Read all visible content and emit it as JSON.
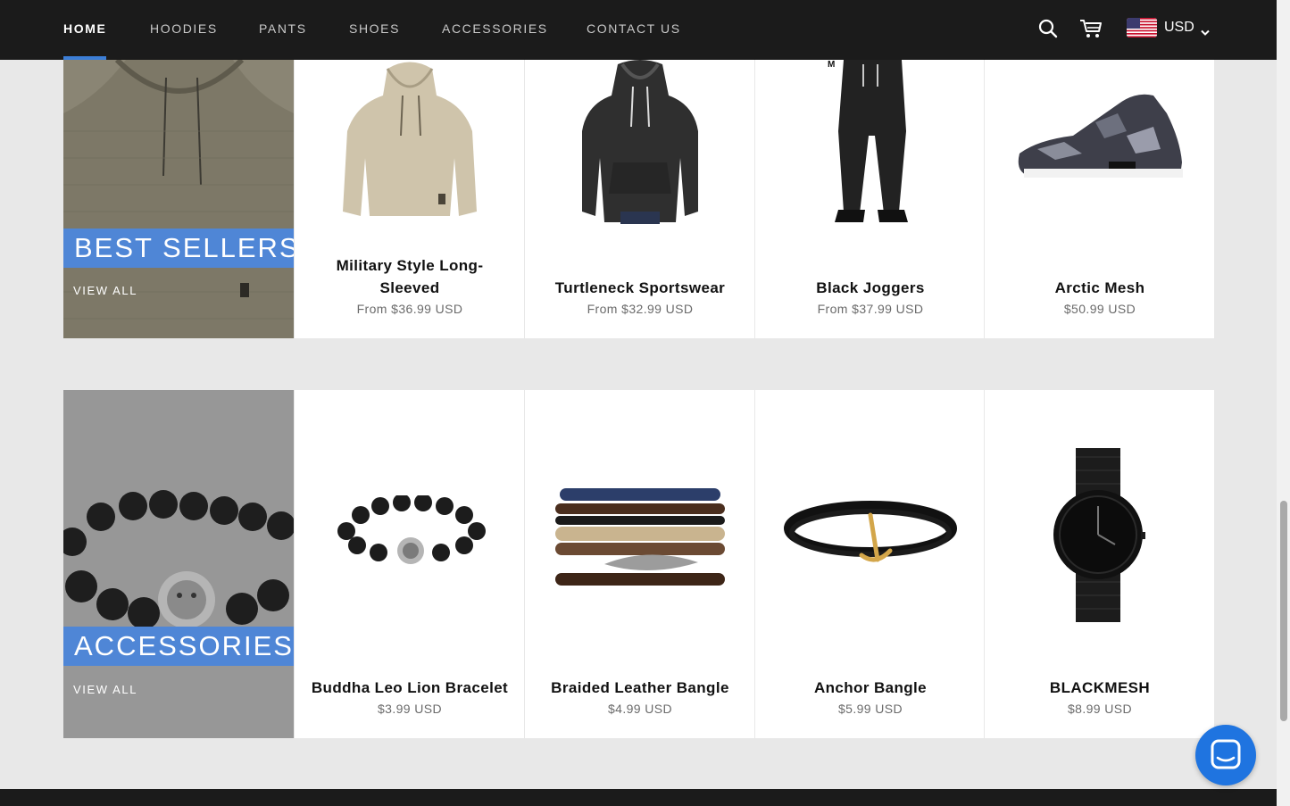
{
  "nav": {
    "items": [
      {
        "label": "HOME",
        "active": true
      },
      {
        "label": "HOODIES",
        "active": false
      },
      {
        "label": "PANTS",
        "active": false
      },
      {
        "label": "SHOES",
        "active": false
      },
      {
        "label": "ACCESSORIES",
        "active": false
      },
      {
        "label": "CONTACT US",
        "active": false
      }
    ],
    "search_icon": "search-icon",
    "cart_icon": "cart-icon",
    "currency": "USD",
    "flag": "us-flag-icon"
  },
  "collections": [
    {
      "name": "BEST SELLERS",
      "view_all": "VIEW ALL",
      "products": [
        {
          "title": "Military Style Long-Sleeved",
          "price": "From $36.99 USD"
        },
        {
          "title": "Turtleneck Sportswear",
          "price": "From $32.99 USD"
        },
        {
          "title": "Black Joggers",
          "price": "From $37.99 USD"
        },
        {
          "title": "Arctic Mesh",
          "price": "$50.99 USD"
        }
      ]
    },
    {
      "name": "ACCESSORIES",
      "view_all": "VIEW ALL",
      "products": [
        {
          "title": "Buddha Leo Lion Bracelet",
          "price": "$3.99 USD"
        },
        {
          "title": "Braided Leather Bangle",
          "price": "$4.99 USD"
        },
        {
          "title": "Anchor Bangle",
          "price": "$5.99 USD"
        },
        {
          "title": "BLACKMESH",
          "price": "$8.99 USD"
        }
      ]
    }
  ],
  "chat_icon": "chat-bubble-icon",
  "colors": {
    "nav_bg": "#1b1b1b",
    "accent": "#4f86d6",
    "chat": "#1f74e0",
    "page_bg": "#e8e8e8"
  }
}
